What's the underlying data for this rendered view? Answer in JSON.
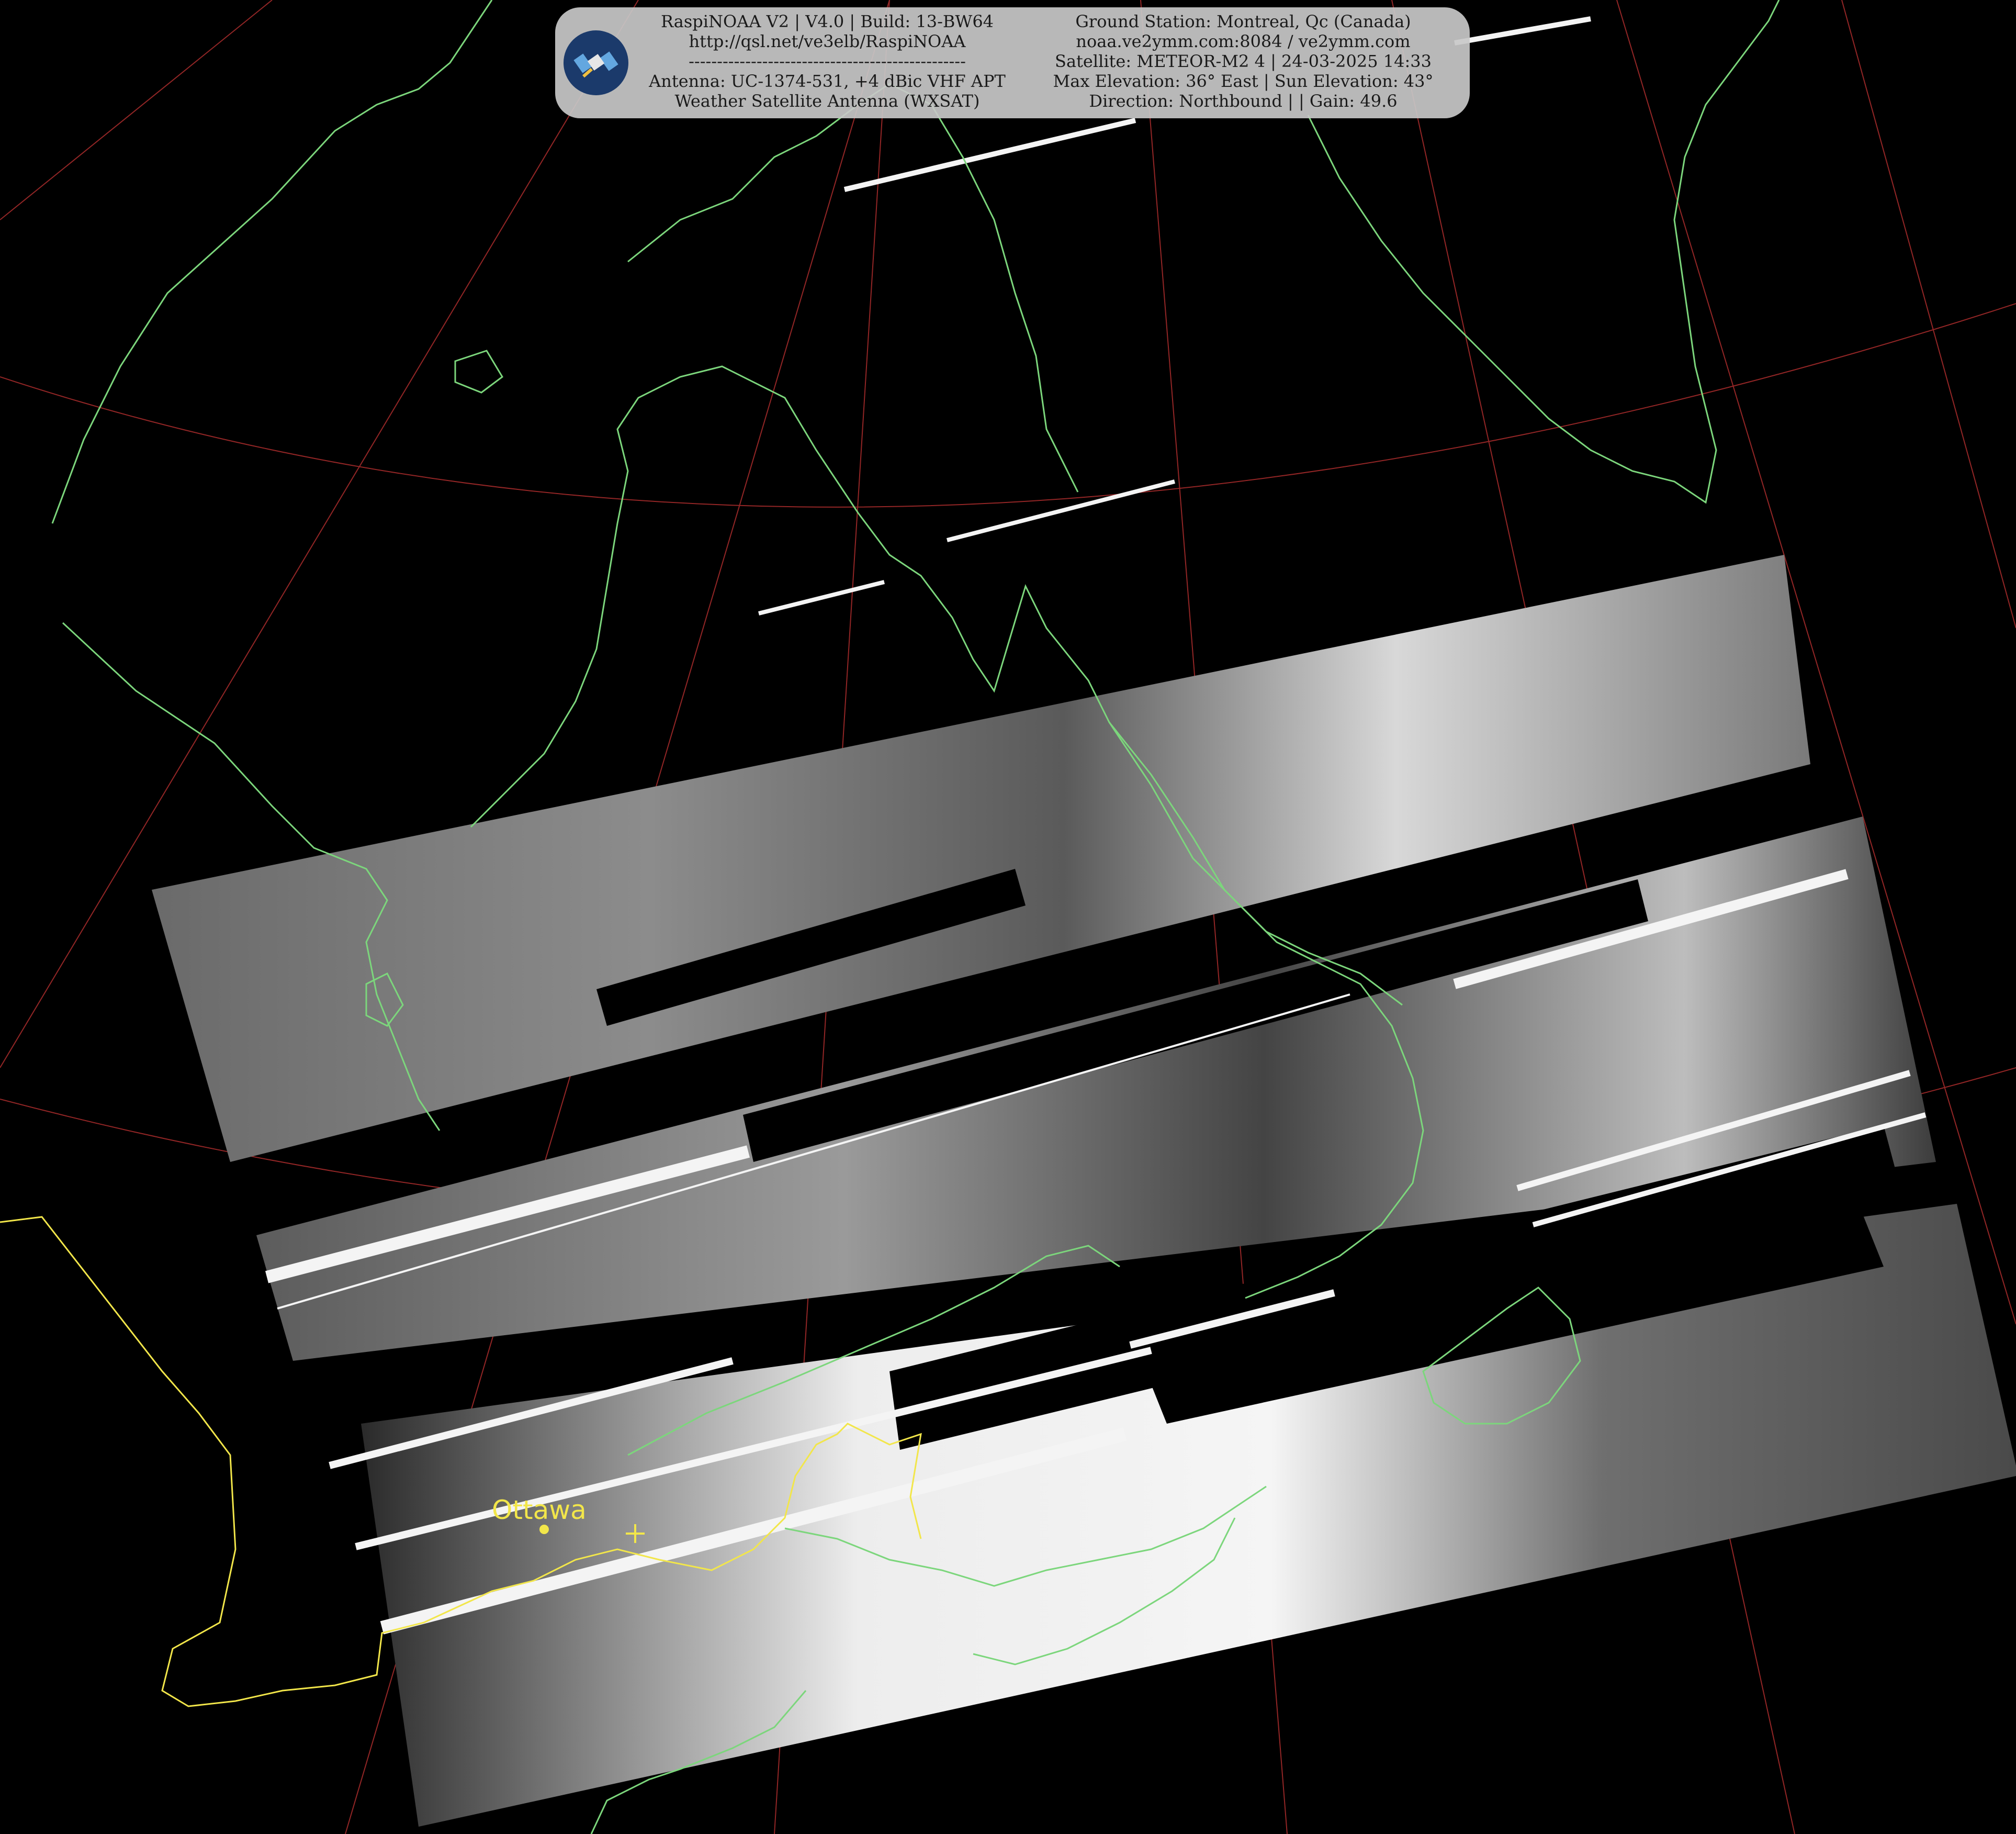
{
  "info": {
    "left_lines": [
      "RaspiNOAA V2 | V4.0 | Build: 13-BW64",
      "http://qsl.net/ve3elb/RaspiNOAA",
      "-------------------------------------------------",
      "Antenna: UC-1374-531, +4 dBic VHF APT",
      "Weather Satellite Antenna (WXSAT)"
    ],
    "right_lines": [
      "Ground Station: Montreal, Qc (Canada)",
      "noaa.ve2ymm.com:8084 / ve2ymm.com",
      "Satellite: METEOR-M2 4 | 24-03-2025 14:33",
      "Max Elevation: 36° East | Sun Elevation: 43°",
      "Direction: Northbound | | Gain: 49.6"
    ]
  },
  "map": {
    "city_label": "Ottawa",
    "colors": {
      "background": "#000000",
      "coastline": "#7cd67c",
      "border": "#f2e64a",
      "graticule": "#b83030",
      "panel": "#c8c8c8"
    },
    "icons": [
      "satellite-logo-icon",
      "ground-station-marker-icon",
      "city-marker-icon"
    ]
  }
}
